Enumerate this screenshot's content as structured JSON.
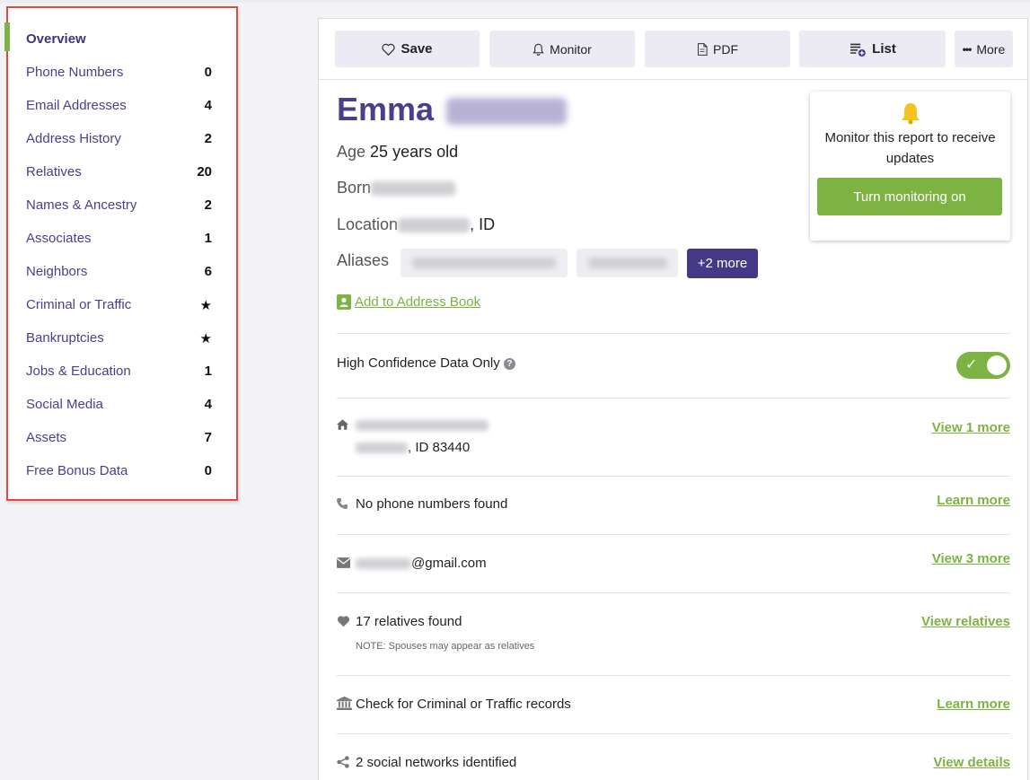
{
  "sidebar": {
    "items": [
      {
        "label": "Overview",
        "count": ""
      },
      {
        "label": "Phone Numbers",
        "count": "0"
      },
      {
        "label": "Email Addresses",
        "count": "4"
      },
      {
        "label": "Address History",
        "count": "2"
      },
      {
        "label": "Relatives",
        "count": "20"
      },
      {
        "label": "Names & Ancestry",
        "count": "2"
      },
      {
        "label": "Associates",
        "count": "1"
      },
      {
        "label": "Neighbors",
        "count": "6"
      },
      {
        "label": "Criminal or Traffic",
        "count": "★"
      },
      {
        "label": "Bankruptcies",
        "count": "★"
      },
      {
        "label": "Jobs & Education",
        "count": "1"
      },
      {
        "label": "Social Media",
        "count": "4"
      },
      {
        "label": "Assets",
        "count": "7"
      },
      {
        "label": "Free Bonus Data",
        "count": "0"
      }
    ]
  },
  "toolbar": {
    "save": "Save",
    "monitor": "Monitor",
    "pdf": "PDF",
    "list": "List",
    "more": "More"
  },
  "report": {
    "first_name": "Emma",
    "age_label": "Age",
    "age_value": "25 years old",
    "born_label": "Born",
    "location_label": "Location",
    "location_state": ", ID",
    "aliases_label": "Aliases",
    "aliases_more": "+2 more",
    "add_address_book": "Add to Address Book"
  },
  "monitor_box": {
    "text": "Monitor this report to receive updates",
    "button": "Turn monitoring on"
  },
  "high_confidence": {
    "label": "High Confidence Data Only",
    "enabled": true
  },
  "rows": {
    "address_line2": ", ID 83440",
    "address_link": "View 1 more",
    "phone_text": "No phone numbers found",
    "phone_link": "Learn more",
    "email_text": "@gmail.com",
    "email_link": "View 3 more",
    "relatives_text": "17 relatives found",
    "relatives_note": "NOTE: Spouses may appear as relatives",
    "relatives_link": "View relatives",
    "criminal_text": "Check for Criminal or Traffic records",
    "criminal_link": "Learn more",
    "social_text": "2 social networks identified",
    "social_link": "View details"
  },
  "colors": {
    "accent_purple": "#4a3f8a",
    "accent_green": "#7cb342",
    "highlight_red": "#e0484a"
  }
}
